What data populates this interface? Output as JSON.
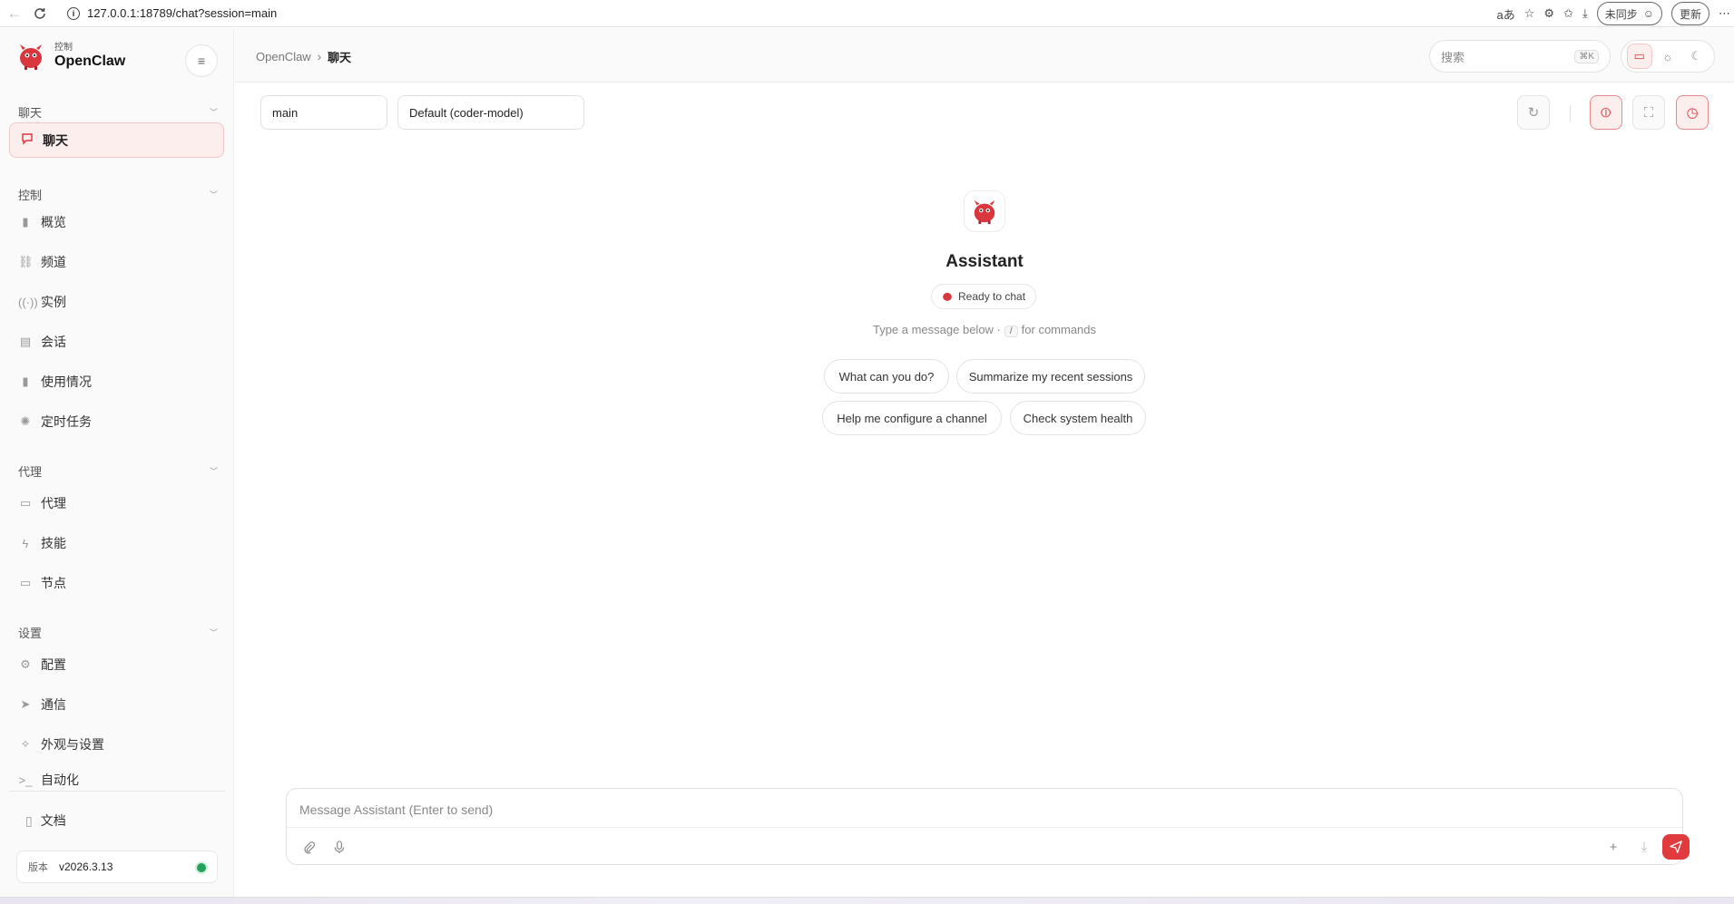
{
  "browser": {
    "url": "127.0.0.1:18789/chat?session=main",
    "sync_label": "未同步",
    "update_label": "更新",
    "read_aloud": "aあ"
  },
  "sidebar": {
    "brand_sub": "控制",
    "brand_title": "OpenClaw",
    "sections": {
      "chat": "聊天",
      "control": "控制",
      "agent": "代理",
      "settings": "设置"
    },
    "items": {
      "chat": "聊天",
      "overview": "概览",
      "channels": "频道",
      "instances": "实例",
      "sessions": "会话",
      "usage": "使用情况",
      "cron": "定时任务",
      "agents": "代理",
      "skills": "技能",
      "nodes": "节点",
      "config": "配置",
      "comm": "通信",
      "appearance": "外观与设置",
      "automation": "自动化"
    },
    "docs": "文档",
    "version_label": "版本",
    "version_value": "v2026.3.13"
  },
  "header": {
    "crumb_root": "OpenClaw",
    "crumb_sep": "›",
    "crumb_current": "聊天",
    "search_placeholder": "搜索",
    "search_shortcut": "⌘K"
  },
  "chat": {
    "session": "main",
    "model": "Default (coder-model)",
    "assistant_name": "Assistant",
    "status": "Ready to chat",
    "hint_before": "Type a message below ·",
    "hint_key": "/",
    "hint_after": "for commands",
    "suggestions": [
      "What can you do?",
      "Summarize my recent sessions",
      "Help me configure a channel",
      "Check system health"
    ],
    "composer_placeholder": "Message Assistant (Enter to send)"
  },
  "colors": {
    "accent": "#e03a3e",
    "accent_soft": "#fdeeee",
    "online": "#22a35a"
  }
}
